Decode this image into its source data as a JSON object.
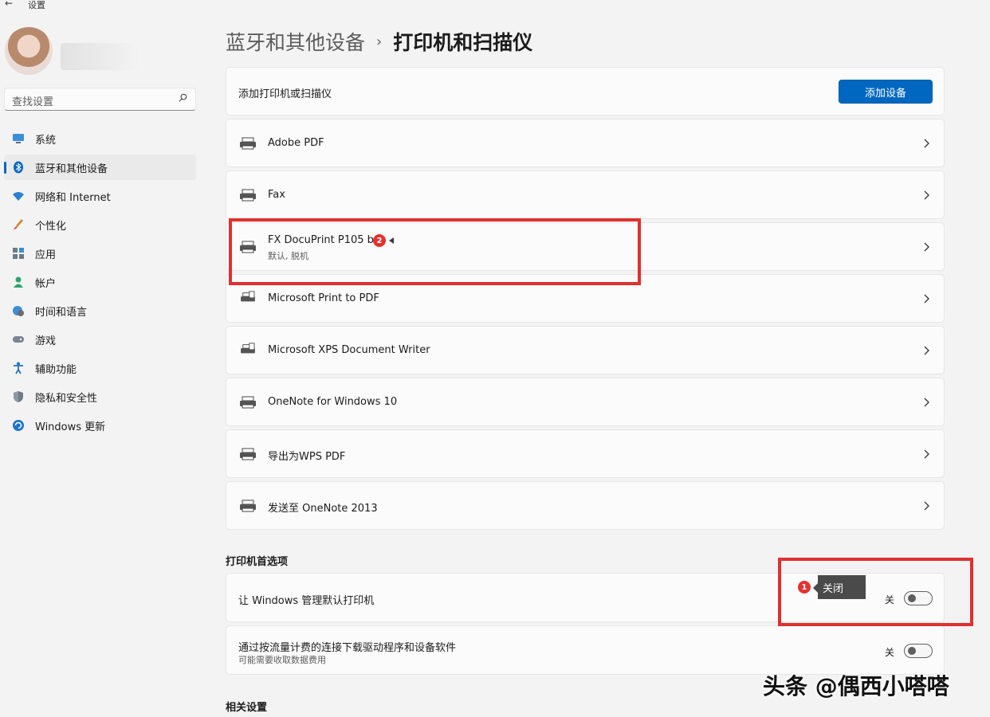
{
  "app": {
    "title": "设置"
  },
  "search": {
    "placeholder": "查找设置"
  },
  "sidebar": {
    "items": [
      {
        "label": "系统",
        "icon": "monitor-icon"
      },
      {
        "label": "蓝牙和其他设备",
        "icon": "bluetooth-icon",
        "active": true
      },
      {
        "label": "网络和 Internet",
        "icon": "wifi-icon"
      },
      {
        "label": "个性化",
        "icon": "brush-icon"
      },
      {
        "label": "应用",
        "icon": "apps-icon"
      },
      {
        "label": "帐户",
        "icon": "person-icon"
      },
      {
        "label": "时间和语言",
        "icon": "globe-clock-icon"
      },
      {
        "label": "游戏",
        "icon": "gamepad-icon"
      },
      {
        "label": "辅助功能",
        "icon": "accessibility-icon"
      },
      {
        "label": "隐私和安全性",
        "icon": "shield-icon"
      },
      {
        "label": "Windows 更新",
        "icon": "update-icon"
      }
    ]
  },
  "breadcrumb": {
    "parent": "蓝牙和其他设备",
    "separator": "›",
    "current": "打印机和扫描仪"
  },
  "add_printer": {
    "label": "添加打印机或扫描仪",
    "button": "添加设备"
  },
  "printers": [
    {
      "name": "Adobe PDF",
      "status": ""
    },
    {
      "name": "Fax",
      "status": ""
    },
    {
      "name": "FX DocuPrint P105 b",
      "status": "默认, 脱机"
    },
    {
      "name": "Microsoft Print to PDF",
      "status": ""
    },
    {
      "name": "Microsoft XPS Document Writer",
      "status": ""
    },
    {
      "name": "OneNote for Windows 10",
      "status": ""
    },
    {
      "name": "导出为WPS PDF",
      "status": ""
    },
    {
      "name": "发送至 OneNote 2013",
      "status": ""
    }
  ],
  "preferences": {
    "title": "打印机首选项",
    "items": [
      {
        "label": "让 Windows 管理默认打印机",
        "sub": "",
        "state": "关",
        "on": false
      },
      {
        "label": "通过按流量计费的连接下载驱动程序和设备软件",
        "sub": "可能需要收取数据费用",
        "state": "关",
        "on": false
      }
    ]
  },
  "related": {
    "title": "相关设置"
  },
  "annotations": {
    "badge1": "1",
    "badge2": "2",
    "tooltip": "关闭"
  },
  "watermark": "头条 @偶西小嗒嗒",
  "colors": {
    "accent": "#0067c0",
    "annotation_red": "#e03030"
  }
}
